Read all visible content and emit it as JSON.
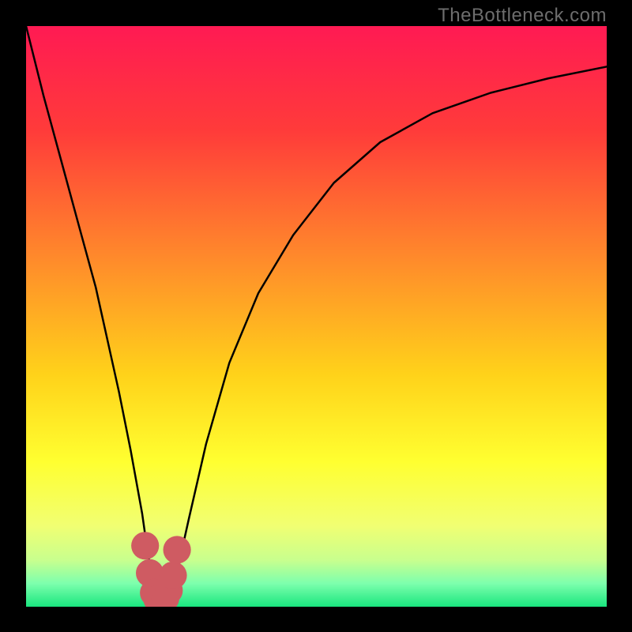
{
  "watermark": "TheBottleneck.com",
  "chart_data": {
    "type": "line",
    "title": "",
    "xlabel": "",
    "ylabel": "",
    "xlim": [
      0,
      100
    ],
    "ylim": [
      0,
      100
    ],
    "gradient_stops": [
      {
        "offset": 0,
        "color": "#ff1a53"
      },
      {
        "offset": 0.18,
        "color": "#ff3b3a"
      },
      {
        "offset": 0.4,
        "color": "#ff8a2b"
      },
      {
        "offset": 0.6,
        "color": "#ffd21a"
      },
      {
        "offset": 0.75,
        "color": "#ffff30"
      },
      {
        "offset": 0.86,
        "color": "#f1ff72"
      },
      {
        "offset": 0.92,
        "color": "#c8ff8e"
      },
      {
        "offset": 0.96,
        "color": "#7dffad"
      },
      {
        "offset": 1.0,
        "color": "#19e67e"
      }
    ],
    "series": [
      {
        "name": "bottleneck-curve",
        "x": [
          0,
          3,
          6,
          9,
          12,
          14,
          16,
          18,
          20,
          21,
          22,
          23,
          24,
          25,
          26,
          28,
          31,
          35,
          40,
          46,
          53,
          61,
          70,
          80,
          90,
          100
        ],
        "y": [
          100,
          88,
          77,
          66,
          55,
          46,
          37,
          27,
          16,
          9,
          4,
          1,
          1,
          2,
          6,
          15,
          28,
          42,
          54,
          64,
          73,
          80,
          85,
          88.5,
          91,
          93
        ]
      }
    ],
    "marker_region": {
      "name": "optimal-zone",
      "points_x": [
        20.5,
        21.3,
        22.0,
        22.6,
        23.3,
        24.0,
        24.6,
        25.3,
        26.0
      ],
      "points_y": [
        10.5,
        5.8,
        2.4,
        1.3,
        1.1,
        1.5,
        2.8,
        5.4,
        9.8
      ],
      "color": "#cf5b62",
      "radius": 2.4
    }
  }
}
